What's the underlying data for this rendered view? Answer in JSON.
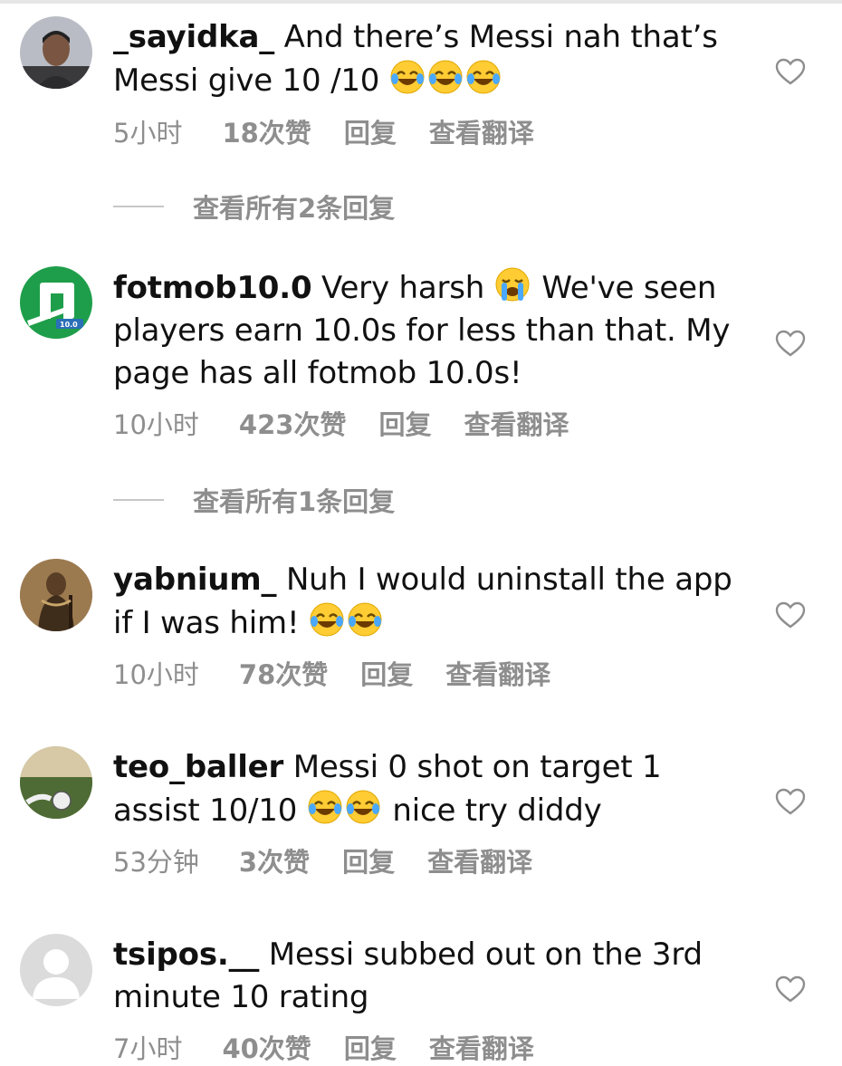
{
  "comments": [
    {
      "username": "_sayidka_",
      "text": " And there’s Messi nah that’s Messi give 10 /10 ",
      "time": "5小时",
      "likes": "18次赞",
      "reply": "回复",
      "translate": "查看翻译",
      "view_replies": "查看所有2条回复"
    },
    {
      "username": "fotmob10.0",
      "text_before_emoji": " Very harsh ",
      "text_after_emoji": " We've seen players earn 10.0s for less than that. My page has all fotmob 10.0s!",
      "avatar_badge": "10.0",
      "time": "10小时",
      "likes": "423次赞",
      "reply": "回复",
      "translate": "查看翻译",
      "view_replies": "查看所有1条回复"
    },
    {
      "username": "yabnium_",
      "text": " Nuh I would uninstall the app if I was him! ",
      "time": "10小时",
      "likes": "78次赞",
      "reply": "回复",
      "translate": "查看翻译"
    },
    {
      "username": "teo_baller",
      "text_before_emoji": " Messi 0 shot on target 1 assist 10/10 ",
      "text_after_emoji": " nice try diddy",
      "time": "53分钟",
      "likes": "3次赞",
      "reply": "回复",
      "translate": "查看翻译"
    },
    {
      "username": "tsipos.__",
      "text": " Messi subbed out on the 3rd minute 10 rating",
      "time": "7小时",
      "likes": "40次赞",
      "reply": "回复",
      "translate": "查看翻译"
    }
  ],
  "icons": {
    "like": "heart-outline-icon",
    "laugh_emoji": "face-with-tears-of-joy",
    "cry_emoji": "loudly-crying-face"
  },
  "colors": {
    "meta_text": "#8e8e8e",
    "fotmob_green": "#1e9e4a"
  }
}
